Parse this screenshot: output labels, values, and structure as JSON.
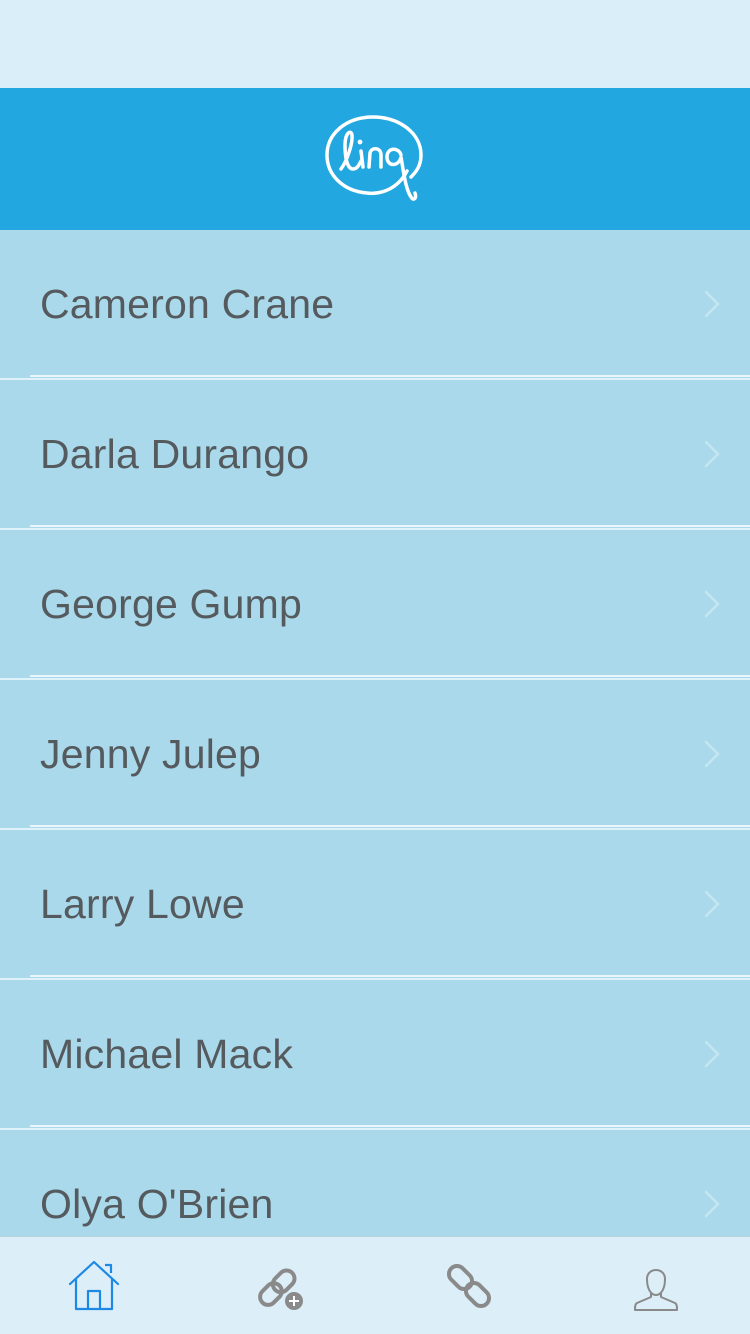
{
  "header": {
    "logo_text": "linq"
  },
  "contacts": [
    {
      "name": "Cameron Crane"
    },
    {
      "name": "Darla Durango"
    },
    {
      "name": "George Gump"
    },
    {
      "name": "Jenny Julep"
    },
    {
      "name": "Larry Lowe"
    },
    {
      "name": "Michael Mack"
    },
    {
      "name": "Olya O'Brien"
    }
  ],
  "tabbar": {
    "items": [
      {
        "icon": "home-icon",
        "active": true
      },
      {
        "icon": "link-add-icon",
        "active": false
      },
      {
        "icon": "link-icon",
        "active": false
      },
      {
        "icon": "profile-icon",
        "active": false
      }
    ]
  },
  "colors": {
    "nav_bar": "#22a7e0",
    "row_background": "#a9d9ea",
    "tab_active": "#1e88e5",
    "tab_inactive": "#8a8a8a"
  }
}
